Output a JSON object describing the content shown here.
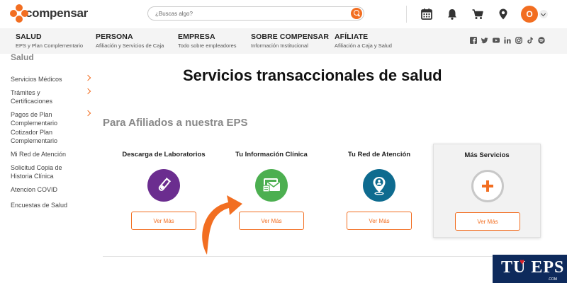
{
  "header": {
    "logo_text": "compensar",
    "search_placeholder": "¿Buscas algo?",
    "avatar_initial": "O",
    "icons": [
      "calendar-icon",
      "bell-icon",
      "cart-icon",
      "location-icon"
    ]
  },
  "nav": {
    "items": [
      {
        "title": "SALUD",
        "sub": "EPS y Plan Complementario"
      },
      {
        "title": "PERSONA",
        "sub": "Afiliación y Servicios de Caja"
      },
      {
        "title": "EMPRESA",
        "sub": "Todo sobre empleadores"
      },
      {
        "title": "SOBRE COMPENSAR",
        "sub": "Información Institucional"
      },
      {
        "title": "AFÍLIATE",
        "sub": "Afiliación a Caja y Salud"
      }
    ],
    "social": [
      "facebook-icon",
      "twitter-icon",
      "youtube-icon",
      "linkedin-icon",
      "instagram-icon",
      "tiktok-icon",
      "spotify-icon"
    ]
  },
  "sidebar": {
    "title": "Salud",
    "items": [
      {
        "label": "Servicios Médicos"
      },
      {
        "label": "Trámites y Certificaciones"
      },
      {
        "label": "Pagos de Plan Complementario"
      },
      {
        "label": "Cotizador Plan Complementario"
      },
      {
        "label": "Mi Red de Atención"
      },
      {
        "label": "Solicitud Copia de Historia Clínica"
      },
      {
        "label": "Atencion COVID"
      },
      {
        "label": "Encuestas de Salud"
      }
    ]
  },
  "main": {
    "title": "Servicios transaccionales de salud",
    "section_title": "Para Afiliados a nuestra EPS",
    "cards": [
      {
        "title": "Descarga de Laboratorios",
        "button": "Ver Más",
        "icon": "test-tube-icon",
        "color": "#6b2d8f"
      },
      {
        "title": "Tu Información Clínica",
        "button": "Ver Más",
        "icon": "clinical-folder-icon",
        "color": "#4caf50"
      },
      {
        "title": "Tu Red de Atención",
        "button": "Ver Más",
        "icon": "location-person-icon",
        "color": "#0e6b8f"
      },
      {
        "title": "Más Servicios",
        "button": "Ver Más",
        "icon": "plus-icon",
        "color": "#f26e21"
      }
    ]
  },
  "watermark": {
    "text": "TU EPS",
    "suffix": ".COM"
  },
  "colors": {
    "accent": "#f26e21",
    "nav_bg": "#f4f4f4",
    "watermark_bg": "#0e2a5c"
  }
}
